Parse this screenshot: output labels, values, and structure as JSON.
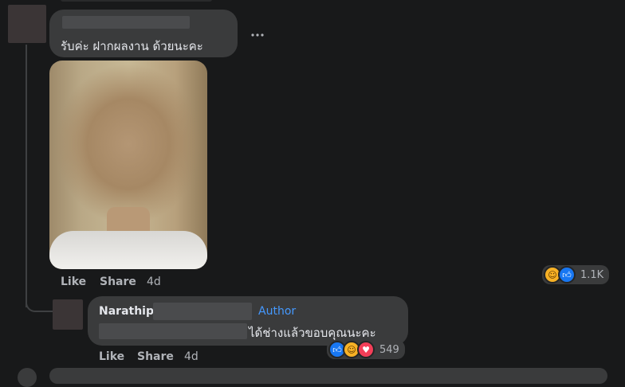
{
  "comment1": {
    "text": "รับค่ะ ฝากผลงาน ด้วยนะคะ",
    "more_icon": "more-horizontal-icon",
    "actions": {
      "like": "Like",
      "share": "Share",
      "time": "4d"
    },
    "reactions": {
      "icons": [
        "haha-icon",
        "like-icon"
      ],
      "count": "1.1K"
    }
  },
  "reply": {
    "name": "Narathip",
    "badge": "Author",
    "text": "ได้ช่างแล้วขอบคุณนะคะ",
    "actions": {
      "like": "Like",
      "share": "Share",
      "time": "4d"
    },
    "reactions": {
      "icons": [
        "like-icon",
        "haha-icon",
        "love-icon"
      ],
      "count": "549"
    }
  },
  "colors": {
    "background": "#18191a",
    "bubble": "#3a3b3c",
    "author_badge": "#4599ff",
    "text_primary": "#e4e6eb",
    "text_secondary": "#b0b3b8"
  }
}
